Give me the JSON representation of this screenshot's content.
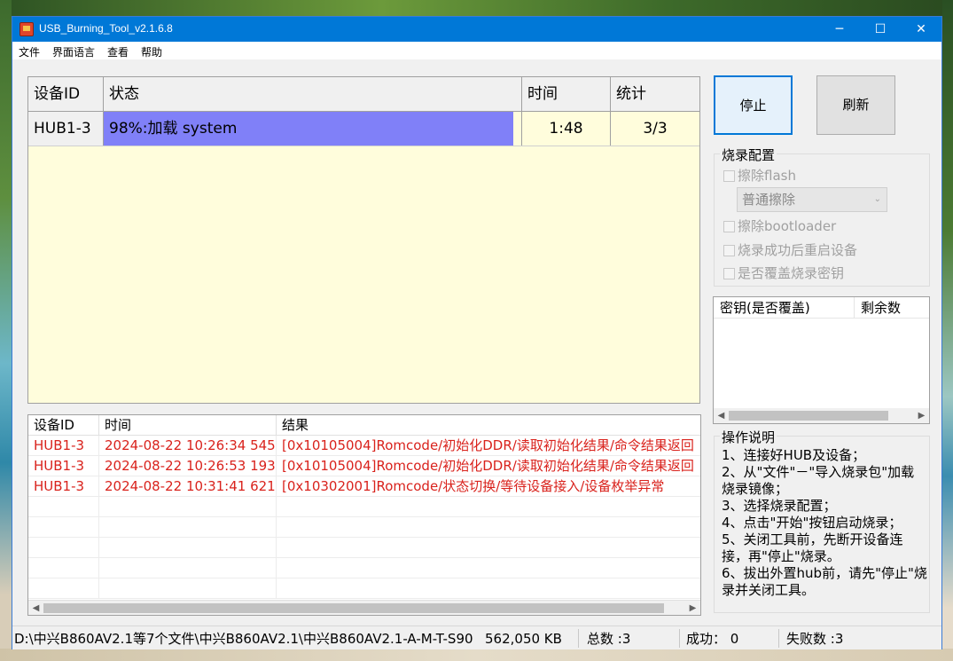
{
  "window": {
    "title": "USB_Burning_Tool_v2.1.6.8"
  },
  "titlebar_buttons": {
    "minimize": "─",
    "maximize": "☐",
    "close": "✕"
  },
  "menu": [
    "文件",
    "界面语言",
    "查看",
    "帮助"
  ],
  "device_grid": {
    "columns": [
      "设备ID",
      "状态",
      "时间",
      "统计"
    ],
    "rows": [
      {
        "device_id": "HUB1-3",
        "status": "98%:加载 system",
        "progress": 0.98,
        "time": "1:48",
        "stats": "3/3"
      }
    ]
  },
  "log_table": {
    "columns": [
      "设备ID",
      "时间",
      "结果"
    ],
    "rows": [
      {
        "device_id": "HUB1-3",
        "time": "2024-08-22 10:26:34 545",
        "result": "[0x10105004]Romcode/初始化DDR/读取初始化结果/命令结果返回"
      },
      {
        "device_id": "HUB1-3",
        "time": "2024-08-22 10:26:53 193",
        "result": "[0x10105004]Romcode/初始化DDR/读取初始化结果/命令结果返回"
      },
      {
        "device_id": "HUB1-3",
        "time": "2024-08-22 10:31:41 621",
        "result": "[0x10302001]Romcode/状态切换/等待设备接入/设备枚举异常"
      }
    ],
    "error_color": "#d9221c"
  },
  "buttons": {
    "stop": "停止",
    "refresh": "刷新"
  },
  "burn_config": {
    "legend": "烧录配置",
    "erase_flash": "擦除flash",
    "erase_mode": "普通擦除",
    "erase_bootloader": "擦除bootloader",
    "reboot_after": "烧录成功后重启设备",
    "overwrite_key": "是否覆盖烧录密钥"
  },
  "key_list": {
    "columns": [
      "密钥(是否覆盖)",
      "剩余数"
    ]
  },
  "help": {
    "legend": "操作说明",
    "lines": [
      "1、连接好HUB及设备；",
      "2、从\"文件\"－\"导入烧录包\"加载烧录镜像；",
      "3、选择烧录配置；",
      "4、点击\"开始\"按钮启动烧录；",
      "5、关闭工具前，先断开设备连接，再\"停止\"烧录。",
      "6、拔出外置hub前，请先\"停止\"烧录并关闭工具。"
    ]
  },
  "status_bar": {
    "file": "D:\\中兴B860AV2.1等7个文件\\中兴B860AV2.1\\中兴B860AV2.1-A-M-T-S90",
    "size": "562,050 KB",
    "total": "总数 :3",
    "success": "成功： 0",
    "fail": "失败数 :3"
  },
  "colors": {
    "accent": "#0078d7",
    "progress": "#8080f8",
    "grid_bg": "#fffddc"
  }
}
